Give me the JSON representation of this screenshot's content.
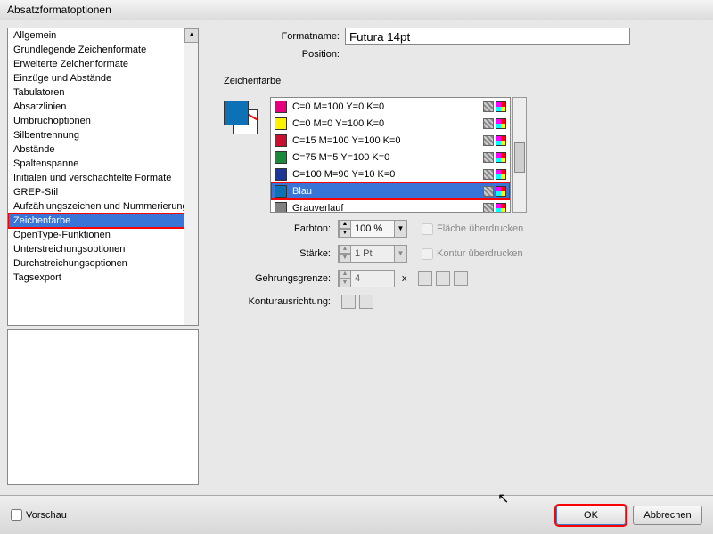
{
  "dialog_title": "Absatzformatoptionen",
  "header": {
    "formatname_label": "Formatname:",
    "formatname_value": "Futura 14pt",
    "position_label": "Position:"
  },
  "sidebar": {
    "items": [
      "Allgemein",
      "Grundlegende Zeichenformate",
      "Erweiterte Zeichenformate",
      "Einzüge und Abstände",
      "Tabulatoren",
      "Absatzlinien",
      "Umbruchoptionen",
      "Silbentrennung",
      "Abstände",
      "Spaltenspanne",
      "Initialen und verschachtelte Formate",
      "GREP-Stil",
      "Aufzählungszeichen und Nummerierung",
      "Zeichenfarbe",
      "OpenType-Funktionen",
      "Unterstreichungsoptionen",
      "Durchstreichungsoptionen",
      "Tagsexport"
    ],
    "selected_index": 13
  },
  "section_title": "Zeichenfarbe",
  "colors": {
    "items": [
      {
        "name": "C=0 M=100 Y=0 K=0",
        "hex": "#e6007e"
      },
      {
        "name": "C=0 M=0 Y=100 K=0",
        "hex": "#fff200"
      },
      {
        "name": "C=15 M=100 Y=100 K=0",
        "hex": "#c8102e"
      },
      {
        "name": "C=75 M=5 Y=100 K=0",
        "hex": "#1a8a3a"
      },
      {
        "name": "C=100 M=90 Y=10 K=0",
        "hex": "#1c3796"
      },
      {
        "name": "Blau",
        "hex": "#0c72b5"
      },
      {
        "name": "Grauverlauf",
        "hex": "#808080"
      }
    ],
    "selected_index": 5
  },
  "fields": {
    "tint_label": "Farbton:",
    "tint_value": "100 %",
    "stroke_label": "Stärke:",
    "stroke_value": "1 Pt",
    "miter_label": "Gehrungsgrenze:",
    "miter_value": "4",
    "miter_suffix": "x",
    "align_label": "Konturausrichtung:",
    "overprint_fill": "Fläche überdrucken",
    "overprint_stroke": "Kontur überdrucken"
  },
  "footer": {
    "preview": "Vorschau",
    "ok": "OK",
    "cancel": "Abbrechen"
  }
}
